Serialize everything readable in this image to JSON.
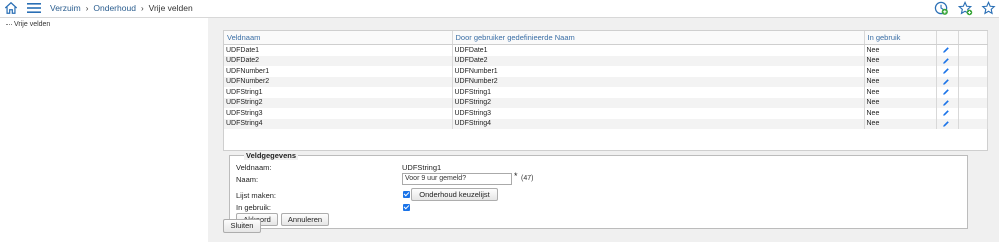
{
  "breadcrumb": {
    "items": [
      "Verzuim",
      "Onderhoud",
      "Vrije velden"
    ],
    "separator": "›"
  },
  "sidebar": {
    "tree_item": "Vrije velden"
  },
  "table": {
    "headers": [
      "Veldnaam",
      "Door gebruiker gedefinieerde Naam",
      "In gebruik"
    ],
    "rows": [
      {
        "veldnaam": "UDFDate1",
        "naam": "UDFDate1",
        "in_gebruik": "Nee"
      },
      {
        "veldnaam": "UDFDate2",
        "naam": "UDFDate2",
        "in_gebruik": "Nee"
      },
      {
        "veldnaam": "UDFNumber1",
        "naam": "UDFNumber1",
        "in_gebruik": "Nee"
      },
      {
        "veldnaam": "UDFNumber2",
        "naam": "UDFNumber2",
        "in_gebruik": "Nee"
      },
      {
        "veldnaam": "UDFString1",
        "naam": "UDFString1",
        "in_gebruik": "Nee"
      },
      {
        "veldnaam": "UDFString2",
        "naam": "UDFString2",
        "in_gebruik": "Nee"
      },
      {
        "veldnaam": "UDFString3",
        "naam": "UDFString3",
        "in_gebruik": "Nee"
      },
      {
        "veldnaam": "UDFString4",
        "naam": "UDFString4",
        "in_gebruik": "Nee"
      }
    ]
  },
  "details": {
    "legend": "Veldgegevens",
    "veldnaam_label": "Veldnaam:",
    "veldnaam_value": "UDFString1",
    "naam_label": "Naam:",
    "naam_value": "Voor 9 uur gemeld?",
    "required_marker": "*",
    "char_count": "(47)",
    "lijst_label": "Lijst maken:",
    "lijst_checked": true,
    "keuzelijst_button": "Onderhoud keuzelijst",
    "ingebruik_label": "In gebruik:",
    "ingebruik_checked": true,
    "ok_button": "Akkoord",
    "cancel_button": "Annuleren"
  },
  "close_button": "Sluiten",
  "colors": {
    "link": "#2a5d8f",
    "accent": "#1a73e8",
    "header_text": "#3a6ea5",
    "background": "#f0f0f0"
  },
  "icons": [
    "home-icon",
    "menu-icon",
    "clock-icon",
    "star-plus-icon",
    "star-icon",
    "pencil-icon"
  ]
}
